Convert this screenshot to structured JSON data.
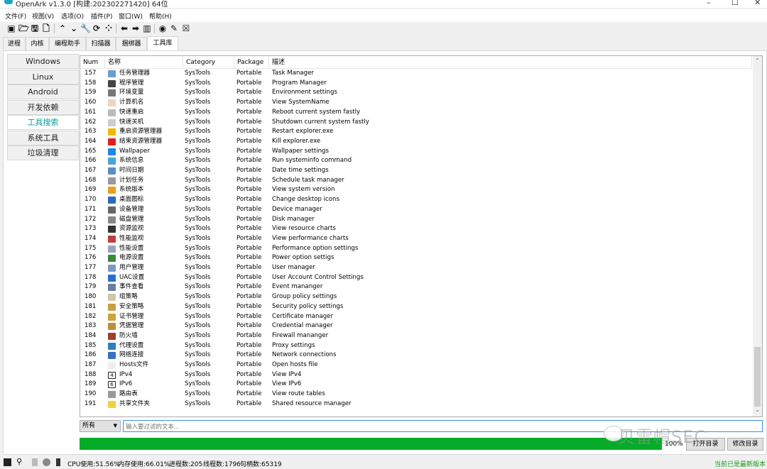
{
  "window": {
    "title": "OpenArk v1.3.0 [构建:202302271420]  64位",
    "controls": [
      "–",
      "☐",
      "✕"
    ]
  },
  "menu": [
    "文件(F)",
    "视图(V)",
    "选项(O)",
    "插件(P)",
    "窗口(W)",
    "帮助(H)"
  ],
  "toolbar": [
    {
      "icon": "console-icon",
      "glyph": "▣"
    },
    {
      "icon": "open-folder-icon",
      "glyph": "🗁"
    },
    {
      "icon": "save-icon",
      "glyph": "🖫"
    },
    {
      "icon": "document-icon",
      "glyph": "🗋"
    },
    {
      "icon": "up-icon",
      "glyph": "⌃"
    },
    {
      "icon": "down-icon",
      "glyph": "⌄"
    },
    {
      "icon": "wrench-icon",
      "glyph": "🔧"
    },
    {
      "icon": "refresh-icon",
      "glyph": "⟳"
    },
    {
      "icon": "grid-icon",
      "glyph": "⁘"
    },
    {
      "icon": "arrow-left-icon",
      "glyph": "⬅"
    },
    {
      "icon": "arrow-right-icon",
      "glyph": "➡"
    },
    {
      "icon": "map-icon",
      "glyph": "▥"
    },
    {
      "icon": "record-icon",
      "glyph": "◉"
    },
    {
      "icon": "pin-icon",
      "glyph": "✎"
    },
    {
      "icon": "close-box-icon",
      "glyph": "☒"
    }
  ],
  "tabs": [
    "进程",
    "内核",
    "编程助手",
    "扫描器",
    "捆绑器",
    "工具库"
  ],
  "active_tab": 5,
  "sidebar": [
    "Windows",
    "Linux",
    "Android",
    "开发依赖",
    "工具搜索",
    "系统工具",
    "垃圾清理"
  ],
  "active_sidebar": 4,
  "table": {
    "columns": [
      "Num",
      "名称",
      "Category",
      "Package",
      "描述"
    ],
    "rows": [
      {
        "num": "157",
        "name": "任务管理器",
        "cat": "SysTools",
        "pkg": "Portable",
        "desc": "Task Manager",
        "icon": "task-manager-icon",
        "color": "#6a9fc9"
      },
      {
        "num": "158",
        "name": "程序管理",
        "cat": "SysTools",
        "pkg": "Portable",
        "desc": "Program Manager",
        "icon": "program-manager-icon",
        "color": "#444444"
      },
      {
        "num": "159",
        "name": "环境变量",
        "cat": "SysTools",
        "pkg": "Portable",
        "desc": "Environment settings",
        "icon": "environment-icon",
        "color": "#777777"
      },
      {
        "num": "160",
        "name": "计算机名",
        "cat": "SysTools",
        "pkg": "Portable",
        "desc": "View SystemName",
        "icon": "computer-name-icon",
        "color": "#e8d6c0"
      },
      {
        "num": "161",
        "name": "快速重启",
        "cat": "SysTools",
        "pkg": "Portable",
        "desc": "Reboot current system fastly",
        "icon": "gear-icon",
        "color": "#bbbbbb"
      },
      {
        "num": "162",
        "name": "快速关机",
        "cat": "SysTools",
        "pkg": "Portable",
        "desc": "Shutdown current system fastly",
        "icon": "power-icon",
        "color": "#cccccc"
      },
      {
        "num": "163",
        "name": "重启资源管理器",
        "cat": "SysTools",
        "pkg": "Portable",
        "desc": "Restart explorer.exe",
        "icon": "folder-restart-icon",
        "color": "#f5b800"
      },
      {
        "num": "164",
        "name": "结束资源管理器",
        "cat": "SysTools",
        "pkg": "Portable",
        "desc": "Kill explorer.exe",
        "icon": "folder-kill-icon",
        "color": "#e02020"
      },
      {
        "num": "165",
        "name": "Wallpaper",
        "cat": "SysTools",
        "pkg": "Portable",
        "desc": "Wallpaper settings",
        "icon": "wallpaper-icon",
        "color": "#1e88e5"
      },
      {
        "num": "166",
        "name": "系统信息",
        "cat": "SysTools",
        "pkg": "Portable",
        "desc": "Run systeminfo command",
        "icon": "monitor-icon",
        "color": "#4aa3df"
      },
      {
        "num": "167",
        "name": "时间日期",
        "cat": "SysTools",
        "pkg": "Portable",
        "desc": "Date time settings",
        "icon": "datetime-icon",
        "color": "#5a8fc0"
      },
      {
        "num": "168",
        "name": "计划任务",
        "cat": "SysTools",
        "pkg": "Portable",
        "desc": "Schedule task manager",
        "icon": "clock-icon",
        "color": "#999999"
      },
      {
        "num": "169",
        "name": "系统版本",
        "cat": "SysTools",
        "pkg": "Portable",
        "desc": "View system version",
        "icon": "windows-logo-icon",
        "color": "#e8a020"
      },
      {
        "num": "170",
        "name": "桌面图标",
        "cat": "SysTools",
        "pkg": "Portable",
        "desc": "Change desktop icons",
        "icon": "desktop-icon",
        "color": "#2e6db4"
      },
      {
        "num": "171",
        "name": "设备管理",
        "cat": "SysTools",
        "pkg": "Portable",
        "desc": "Device manager",
        "icon": "device-manager-icon",
        "color": "#666666"
      },
      {
        "num": "172",
        "name": "磁盘管理",
        "cat": "SysTools",
        "pkg": "Portable",
        "desc": "Disk manager",
        "icon": "disk-icon",
        "color": "#888888"
      },
      {
        "num": "173",
        "name": "资源监视",
        "cat": "SysTools",
        "pkg": "Portable",
        "desc": "View resource charts",
        "icon": "resource-monitor-icon",
        "color": "#333333"
      },
      {
        "num": "174",
        "name": "性能监视",
        "cat": "SysTools",
        "pkg": "Portable",
        "desc": "View performance charts",
        "icon": "performance-monitor-icon",
        "color": "#c04040"
      },
      {
        "num": "175",
        "name": "性能设置",
        "cat": "SysTools",
        "pkg": "Portable",
        "desc": "Performance option settings",
        "icon": "performance-settings-icon",
        "color": "#9aa6b8"
      },
      {
        "num": "176",
        "name": "电源设置",
        "cat": "SysTools",
        "pkg": "Portable",
        "desc": "Power option settigs",
        "icon": "power-options-icon",
        "color": "#3a8a3a"
      },
      {
        "num": "177",
        "name": "用户管理",
        "cat": "SysTools",
        "pkg": "Portable",
        "desc": "User manager",
        "icon": "users-icon",
        "color": "#7a9ac0"
      },
      {
        "num": "178",
        "name": "UAC设置",
        "cat": "SysTools",
        "pkg": "Portable",
        "desc": "User Account Control Settings",
        "icon": "uac-shield-icon",
        "color": "#2a6fd0"
      },
      {
        "num": "179",
        "name": "事件查看",
        "cat": "SysTools",
        "pkg": "Portable",
        "desc": "Event mananger",
        "icon": "event-viewer-icon",
        "color": "#6a7fa0"
      },
      {
        "num": "180",
        "name": "组策略",
        "cat": "SysTools",
        "pkg": "Portable",
        "desc": "Group policy settings",
        "icon": "group-policy-icon",
        "color": "#d0c8a8"
      },
      {
        "num": "181",
        "name": "安全策略",
        "cat": "SysTools",
        "pkg": "Portable",
        "desc": "Security policy settings",
        "icon": "security-policy-icon",
        "color": "#c8a040"
      },
      {
        "num": "182",
        "name": "证书管理",
        "cat": "SysTools",
        "pkg": "Portable",
        "desc": "Certificate manager",
        "icon": "certificate-icon",
        "color": "#d0a040"
      },
      {
        "num": "183",
        "name": "凭据管理",
        "cat": "SysTools",
        "pkg": "Portable",
        "desc": "Credential manager",
        "icon": "credential-icon",
        "color": "#b89040"
      },
      {
        "num": "184",
        "name": "防火墙",
        "cat": "SysTools",
        "pkg": "Portable",
        "desc": "Firewall mananger",
        "icon": "firewall-icon",
        "color": "#a0402a"
      },
      {
        "num": "185",
        "name": "代理设置",
        "cat": "SysTools",
        "pkg": "Portable",
        "desc": "Proxy settings",
        "icon": "globe-icon",
        "color": "#2a80c0"
      },
      {
        "num": "186",
        "name": "网络连接",
        "cat": "SysTools",
        "pkg": "Portable",
        "desc": "Network connections",
        "icon": "network-icon",
        "color": "#3a70c0"
      },
      {
        "num": "187",
        "name": "Hosts文件",
        "cat": "SysTools",
        "pkg": "Portable",
        "desc": "Open hosts file",
        "icon": "file-icon",
        "color": "#eeeeee"
      },
      {
        "num": "188",
        "name": "IPv4",
        "cat": "SysTools",
        "pkg": "Portable",
        "desc": "View IPv4",
        "icon": "ipv4-icon",
        "color": "#ffffff",
        "glyph": "4"
      },
      {
        "num": "189",
        "name": "IPv6",
        "cat": "SysTools",
        "pkg": "Portable",
        "desc": "View IPv6",
        "icon": "ipv6-icon",
        "color": "#ffffff",
        "glyph": "6"
      },
      {
        "num": "190",
        "name": "路由表",
        "cat": "SysTools",
        "pkg": "Portable",
        "desc": "View route tables",
        "icon": "route-icon",
        "color": "#999999"
      },
      {
        "num": "191",
        "name": "共享文件夹",
        "cat": "SysTools",
        "pkg": "Portable",
        "desc": "Shared resource manager",
        "icon": "shared-folder-icon",
        "color": "#f0d040"
      }
    ]
  },
  "filter": {
    "select": "所有",
    "placeholder": "输入要过滤的文本..."
  },
  "progress": {
    "value": 100,
    "label": "100%",
    "color": "#06ab29"
  },
  "buttons": {
    "open_dir": "打开目录",
    "modify_dir": "修改目录"
  },
  "watermark": "贝雷帽SEC",
  "status": {
    "cpu": "CPU使用:51.56%",
    "mem": "内存使用:66.01%",
    "procs": "进程数:205",
    "threads": "线程数:1796",
    "handles": "句柄数:65319",
    "latest": "当前已是最新版本"
  }
}
